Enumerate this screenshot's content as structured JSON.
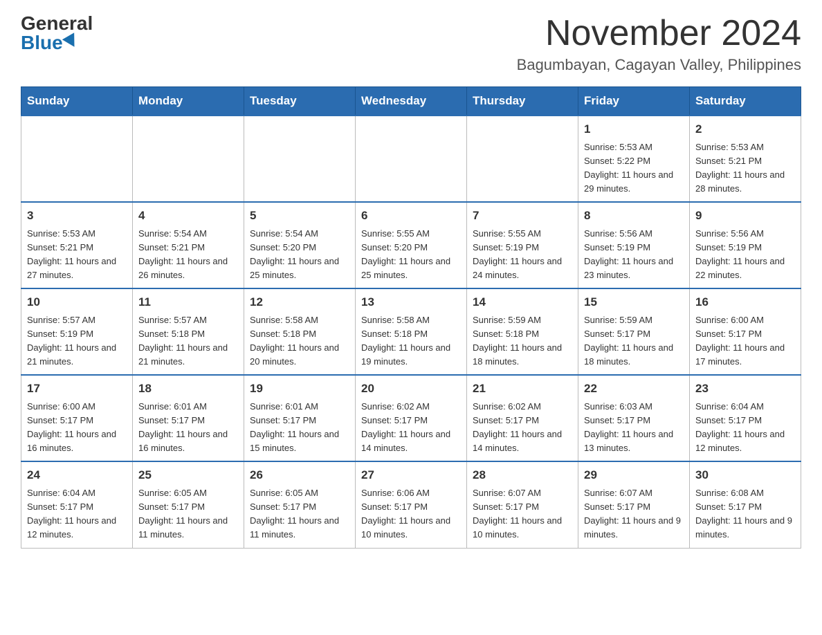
{
  "logo": {
    "general": "General",
    "blue": "Blue"
  },
  "title": "November 2024",
  "location": "Bagumbayan, Cagayan Valley, Philippines",
  "days_of_week": [
    "Sunday",
    "Monday",
    "Tuesday",
    "Wednesday",
    "Thursday",
    "Friday",
    "Saturday"
  ],
  "weeks": [
    [
      {
        "day": "",
        "info": ""
      },
      {
        "day": "",
        "info": ""
      },
      {
        "day": "",
        "info": ""
      },
      {
        "day": "",
        "info": ""
      },
      {
        "day": "",
        "info": ""
      },
      {
        "day": "1",
        "info": "Sunrise: 5:53 AM\nSunset: 5:22 PM\nDaylight: 11 hours and 29 minutes."
      },
      {
        "day": "2",
        "info": "Sunrise: 5:53 AM\nSunset: 5:21 PM\nDaylight: 11 hours and 28 minutes."
      }
    ],
    [
      {
        "day": "3",
        "info": "Sunrise: 5:53 AM\nSunset: 5:21 PM\nDaylight: 11 hours and 27 minutes."
      },
      {
        "day": "4",
        "info": "Sunrise: 5:54 AM\nSunset: 5:21 PM\nDaylight: 11 hours and 26 minutes."
      },
      {
        "day": "5",
        "info": "Sunrise: 5:54 AM\nSunset: 5:20 PM\nDaylight: 11 hours and 25 minutes."
      },
      {
        "day": "6",
        "info": "Sunrise: 5:55 AM\nSunset: 5:20 PM\nDaylight: 11 hours and 25 minutes."
      },
      {
        "day": "7",
        "info": "Sunrise: 5:55 AM\nSunset: 5:19 PM\nDaylight: 11 hours and 24 minutes."
      },
      {
        "day": "8",
        "info": "Sunrise: 5:56 AM\nSunset: 5:19 PM\nDaylight: 11 hours and 23 minutes."
      },
      {
        "day": "9",
        "info": "Sunrise: 5:56 AM\nSunset: 5:19 PM\nDaylight: 11 hours and 22 minutes."
      }
    ],
    [
      {
        "day": "10",
        "info": "Sunrise: 5:57 AM\nSunset: 5:19 PM\nDaylight: 11 hours and 21 minutes."
      },
      {
        "day": "11",
        "info": "Sunrise: 5:57 AM\nSunset: 5:18 PM\nDaylight: 11 hours and 21 minutes."
      },
      {
        "day": "12",
        "info": "Sunrise: 5:58 AM\nSunset: 5:18 PM\nDaylight: 11 hours and 20 minutes."
      },
      {
        "day": "13",
        "info": "Sunrise: 5:58 AM\nSunset: 5:18 PM\nDaylight: 11 hours and 19 minutes."
      },
      {
        "day": "14",
        "info": "Sunrise: 5:59 AM\nSunset: 5:18 PM\nDaylight: 11 hours and 18 minutes."
      },
      {
        "day": "15",
        "info": "Sunrise: 5:59 AM\nSunset: 5:17 PM\nDaylight: 11 hours and 18 minutes."
      },
      {
        "day": "16",
        "info": "Sunrise: 6:00 AM\nSunset: 5:17 PM\nDaylight: 11 hours and 17 minutes."
      }
    ],
    [
      {
        "day": "17",
        "info": "Sunrise: 6:00 AM\nSunset: 5:17 PM\nDaylight: 11 hours and 16 minutes."
      },
      {
        "day": "18",
        "info": "Sunrise: 6:01 AM\nSunset: 5:17 PM\nDaylight: 11 hours and 16 minutes."
      },
      {
        "day": "19",
        "info": "Sunrise: 6:01 AM\nSunset: 5:17 PM\nDaylight: 11 hours and 15 minutes."
      },
      {
        "day": "20",
        "info": "Sunrise: 6:02 AM\nSunset: 5:17 PM\nDaylight: 11 hours and 14 minutes."
      },
      {
        "day": "21",
        "info": "Sunrise: 6:02 AM\nSunset: 5:17 PM\nDaylight: 11 hours and 14 minutes."
      },
      {
        "day": "22",
        "info": "Sunrise: 6:03 AM\nSunset: 5:17 PM\nDaylight: 11 hours and 13 minutes."
      },
      {
        "day": "23",
        "info": "Sunrise: 6:04 AM\nSunset: 5:17 PM\nDaylight: 11 hours and 12 minutes."
      }
    ],
    [
      {
        "day": "24",
        "info": "Sunrise: 6:04 AM\nSunset: 5:17 PM\nDaylight: 11 hours and 12 minutes."
      },
      {
        "day": "25",
        "info": "Sunrise: 6:05 AM\nSunset: 5:17 PM\nDaylight: 11 hours and 11 minutes."
      },
      {
        "day": "26",
        "info": "Sunrise: 6:05 AM\nSunset: 5:17 PM\nDaylight: 11 hours and 11 minutes."
      },
      {
        "day": "27",
        "info": "Sunrise: 6:06 AM\nSunset: 5:17 PM\nDaylight: 11 hours and 10 minutes."
      },
      {
        "day": "28",
        "info": "Sunrise: 6:07 AM\nSunset: 5:17 PM\nDaylight: 11 hours and 10 minutes."
      },
      {
        "day": "29",
        "info": "Sunrise: 6:07 AM\nSunset: 5:17 PM\nDaylight: 11 hours and 9 minutes."
      },
      {
        "day": "30",
        "info": "Sunrise: 6:08 AM\nSunset: 5:17 PM\nDaylight: 11 hours and 9 minutes."
      }
    ]
  ]
}
